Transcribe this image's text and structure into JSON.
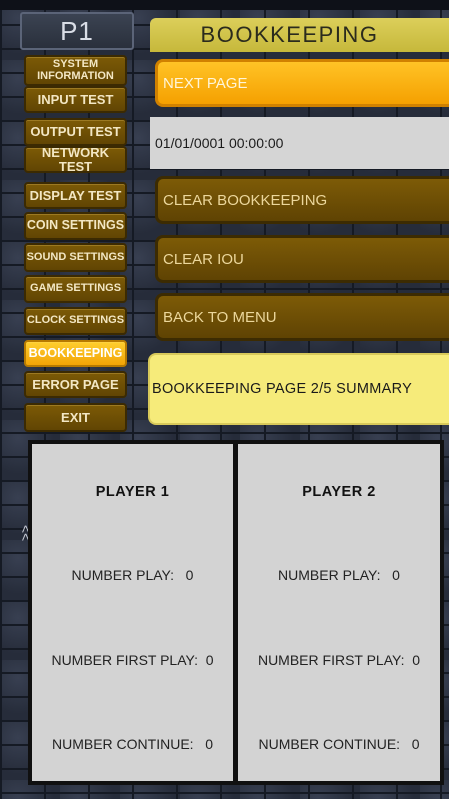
{
  "left_panel": {
    "header": "P1",
    "menu": [
      {
        "id": "system-information",
        "label": "SYSTEM INFORMATION",
        "active": false
      },
      {
        "id": "input-test",
        "label": "INPUT TEST",
        "active": false
      },
      {
        "id": "output-test",
        "label": "OUTPUT TEST",
        "active": false
      },
      {
        "id": "network-test",
        "label": "NETWORK TEST",
        "active": false
      },
      {
        "id": "display-test",
        "label": "DISPLAY TEST",
        "active": false
      },
      {
        "id": "coin-settings",
        "label": "COIN SETTINGS",
        "active": false
      },
      {
        "id": "sound-settings",
        "label": "SOUND SETTINGS",
        "active": false
      },
      {
        "id": "game-settings",
        "label": "GAME SETTINGS",
        "active": false
      },
      {
        "id": "clock-settings",
        "label": "CLOCK SETTINGS",
        "active": false
      },
      {
        "id": "bookkeeping",
        "label": "BOOKKEEPING",
        "active": true
      },
      {
        "id": "error-page",
        "label": "ERROR PAGE",
        "active": false
      },
      {
        "id": "exit",
        "label": "EXIT",
        "active": false
      }
    ]
  },
  "right_panel": {
    "title": "BOOKKEEPING",
    "next_page": "NEXT PAGE",
    "datetime": "01/01/0001 00:00:00",
    "clear_bookkeeping": "CLEAR BOOKKEEPING",
    "clear_iou": "CLEAR IOU",
    "back_to_menu": "BACK TO MENU",
    "summary": "BOOKKEEPING PAGE 2/5 SUMMARY"
  },
  "side_arrow": "<<",
  "players": [
    {
      "title": "PLAYER 1",
      "number_play": "NUMBER PLAY:   0",
      "number_first_play": "NUMBER FIRST PLAY:  0",
      "number_continue": "NUMBER CONTINUE:   0"
    },
    {
      "title": "PLAYER 2",
      "number_play": "NUMBER PLAY:   0",
      "number_first_play": "NUMBER FIRST PLAY:  0",
      "number_continue": "NUMBER CONTINUE:   0"
    }
  ],
  "colors": {
    "menu_button": "#6e5005",
    "menu_active": "#ffc21f",
    "title_bar": "#d4c64d",
    "summary_bar": "#f6eb7a"
  }
}
